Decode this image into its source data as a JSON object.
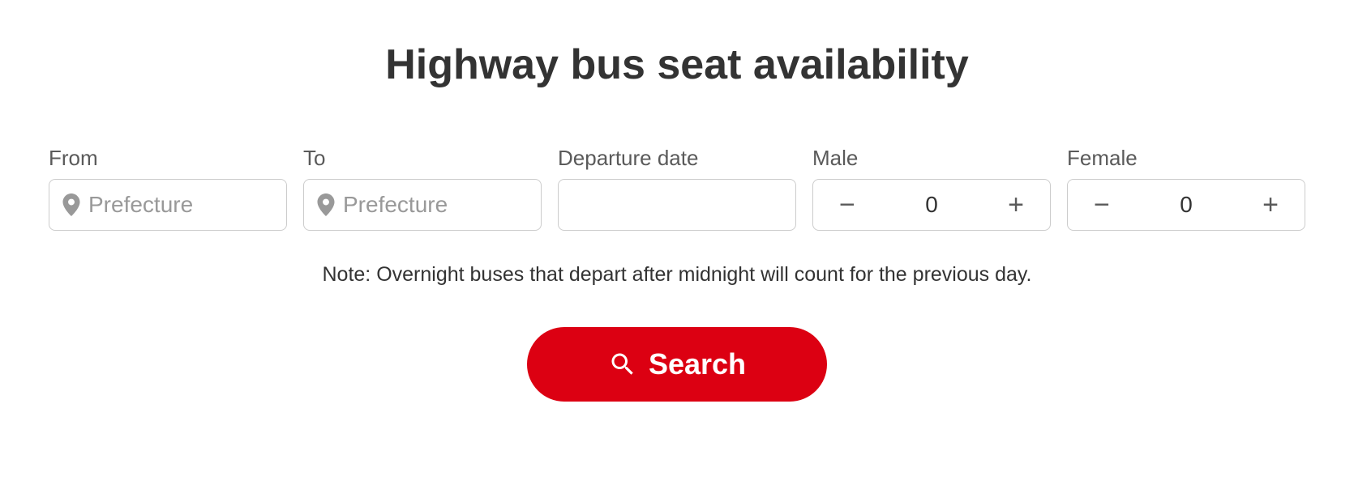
{
  "title": "Highway bus seat availability",
  "form": {
    "from": {
      "label": "From",
      "placeholder": "Prefecture",
      "value": ""
    },
    "to": {
      "label": "To",
      "placeholder": "Prefecture",
      "value": ""
    },
    "date": {
      "label": "Departure date",
      "value": ""
    },
    "male": {
      "label": "Male",
      "value": "0"
    },
    "female": {
      "label": "Female",
      "value": "0"
    }
  },
  "note": "Note: Overnight buses that depart after midnight will count for the previous day.",
  "searchButton": "Search"
}
